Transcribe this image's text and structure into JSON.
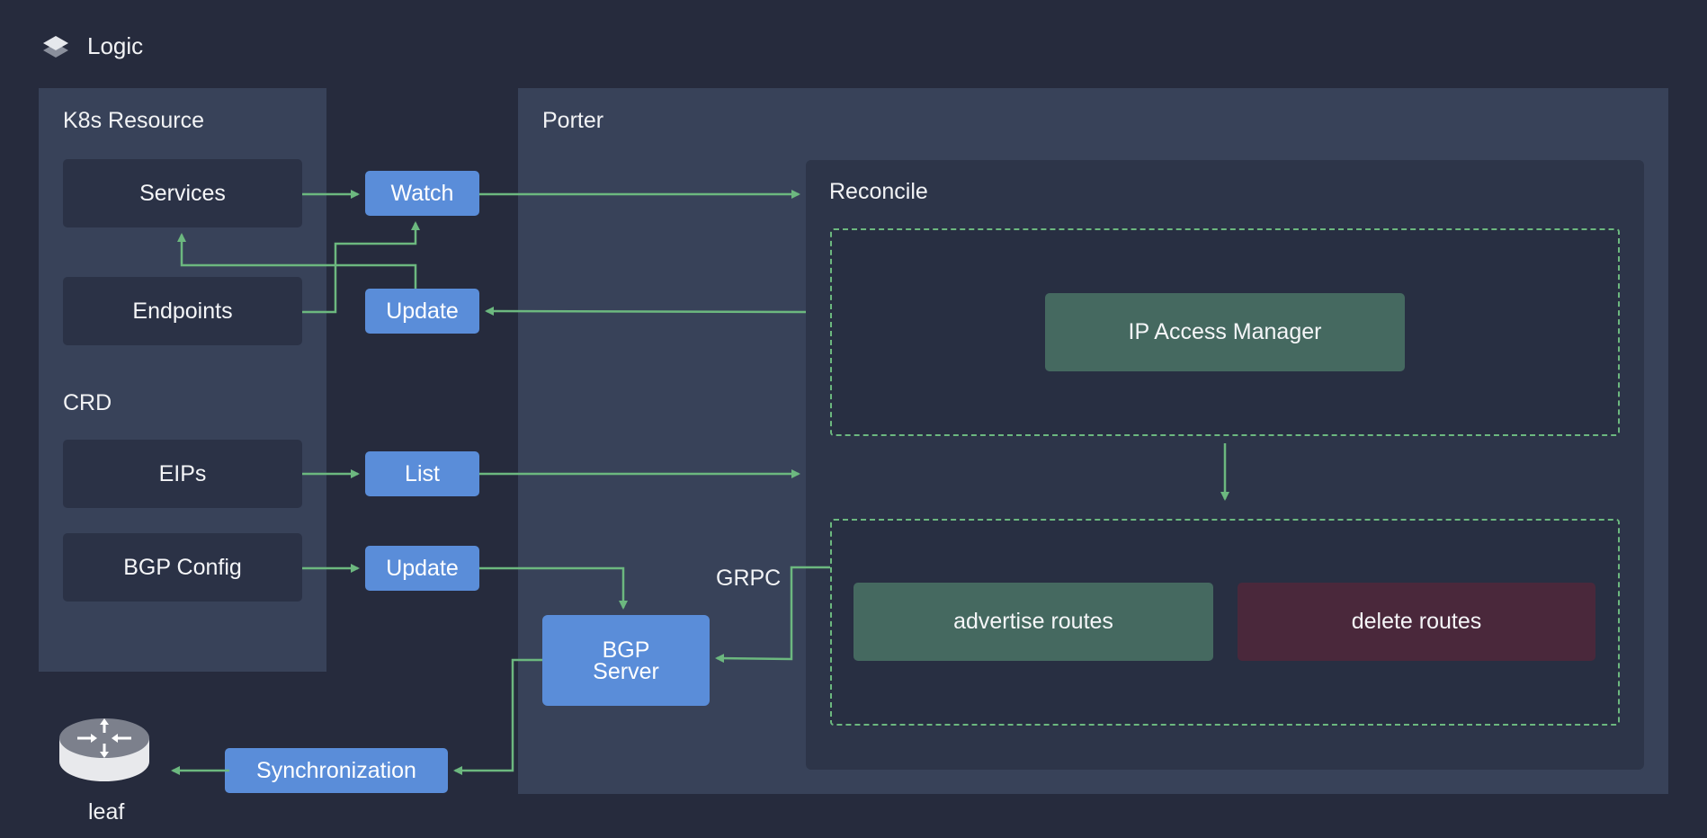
{
  "header": {
    "title": "Logic",
    "icon": "layers-icon"
  },
  "k8s_panel": {
    "title": "K8s Resource",
    "resources": [
      {
        "label": "Services"
      },
      {
        "label": "Endpoints"
      }
    ],
    "crd_title": "CRD",
    "crds": [
      {
        "label": "EIPs"
      },
      {
        "label": "BGP Config"
      }
    ]
  },
  "actions": {
    "watch": "Watch",
    "update_services": "Update",
    "list": "List",
    "update_bgp": "Update",
    "synchronization": "Synchronization"
  },
  "porter_panel": {
    "title": "Porter",
    "reconcile_title": "Reconcile",
    "ip_access_manager": "IP Access Manager",
    "advertise_routes": "advertise routes",
    "delete_routes": "delete routes",
    "bgp_server_line1": "BGP",
    "bgp_server_line2": "Server",
    "grpc_label": "GRPC"
  },
  "leaf": {
    "label": "leaf",
    "icon": "router-icon"
  },
  "colors": {
    "background": "#262b3d",
    "panel": "#384259",
    "action_blue": "#5a8dd9",
    "connector_green": "#6cb87f",
    "manager_green": "#456960",
    "delete_red": "#4a283b"
  }
}
